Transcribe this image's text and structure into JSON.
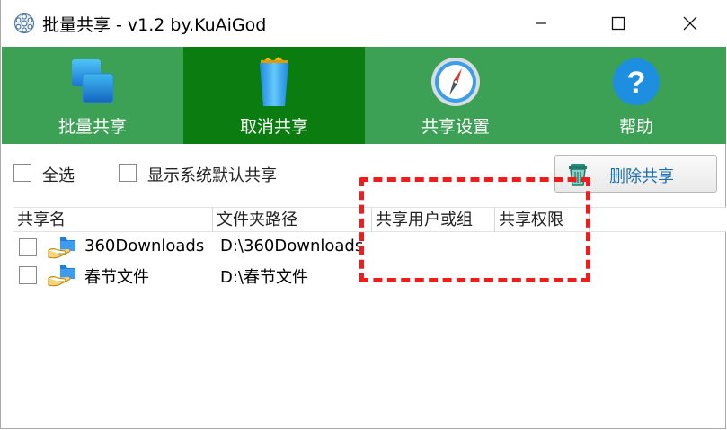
{
  "window": {
    "title": "批量共享 - v1.2 by.KuAiGod"
  },
  "toolbar": {
    "items": [
      {
        "label": "批量共享",
        "icon": "windows-stack-icon",
        "active": false
      },
      {
        "label": "取消共享",
        "icon": "trash-bin-icon",
        "active": true
      },
      {
        "label": "共享设置",
        "icon": "compass-icon",
        "active": false
      },
      {
        "label": "帮助",
        "icon": "help-icon",
        "active": false
      }
    ]
  },
  "options": {
    "select_all": "全选",
    "show_default": "显示系统默认共享",
    "delete_button": "删除共享"
  },
  "list": {
    "columns": [
      "共享名",
      "文件夹路径",
      "共享用户或组",
      "共享权限"
    ],
    "rows": [
      {
        "name": "360Downloads",
        "path": "D:\\360Downloads",
        "users": "",
        "permission": ""
      },
      {
        "name": "春节文件",
        "path": "D:\\春节文件",
        "users": "",
        "permission": ""
      }
    ]
  },
  "colors": {
    "toolbar_bg": "#3da155",
    "toolbar_active": "#0b7d10",
    "annotation": "#ee1c1c",
    "delete_label": "#1e6fb0"
  }
}
